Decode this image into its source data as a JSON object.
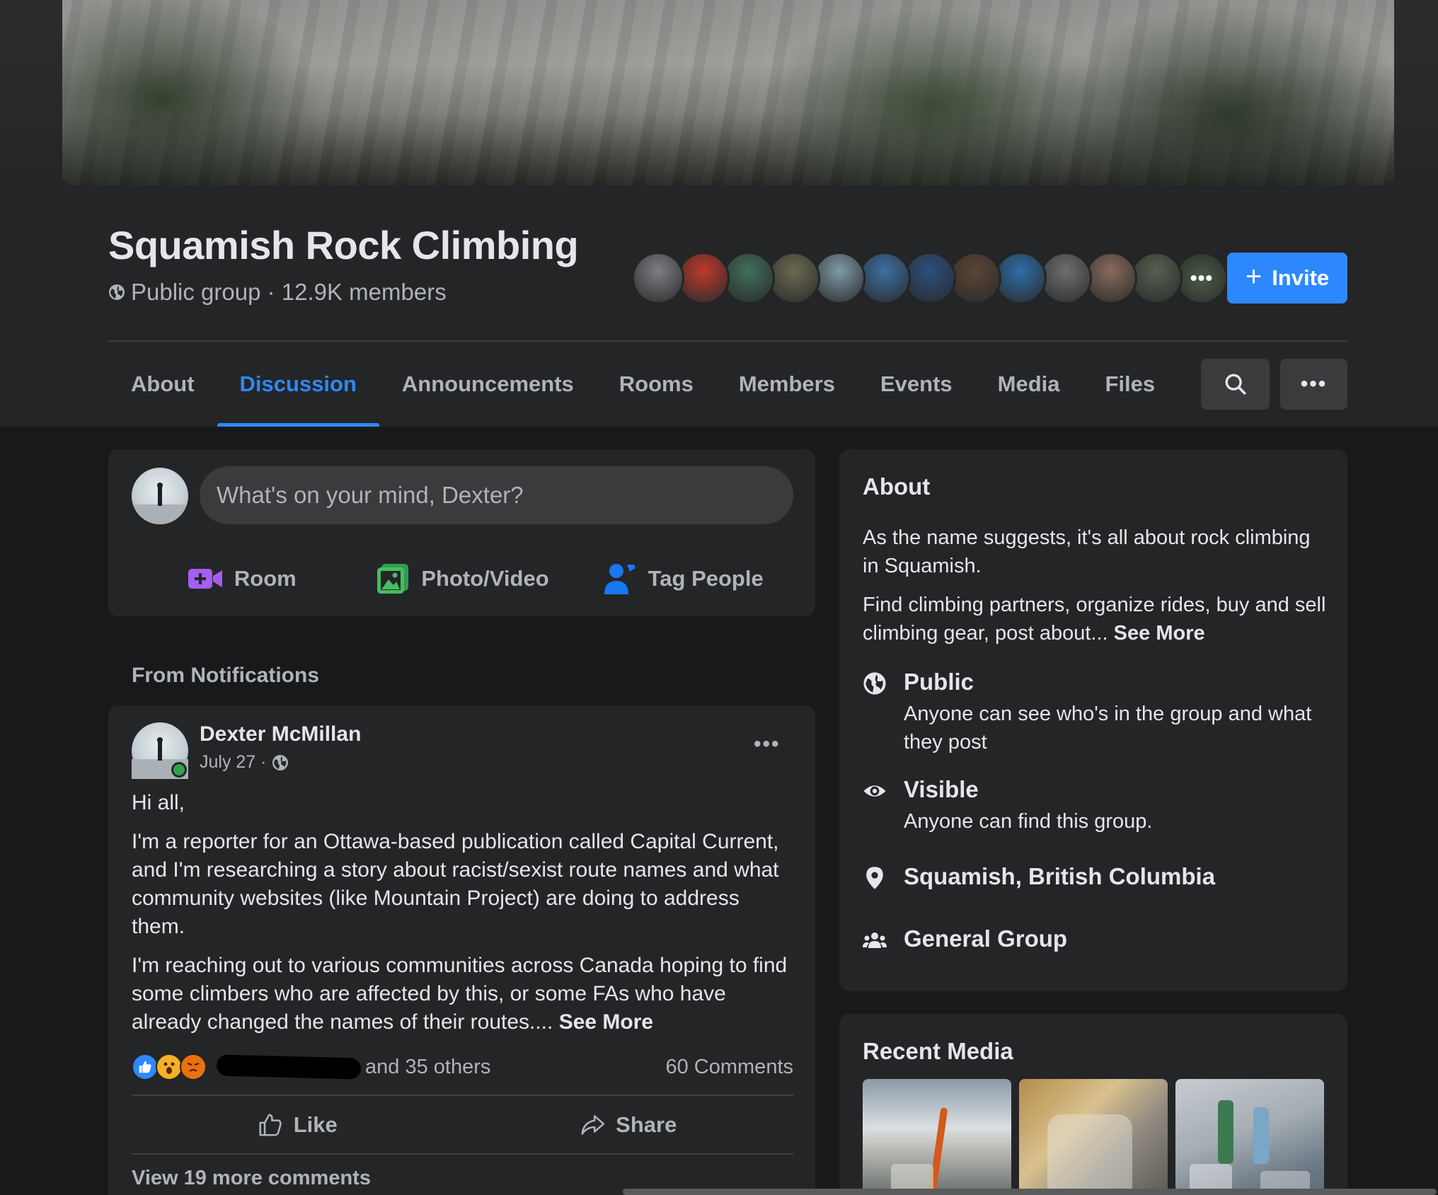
{
  "group": {
    "title": "Squamish Rock Climbing",
    "meta": "Public group · 12.9K members",
    "member_avatar_colors": [
      "#7d7f82",
      "#c0392b",
      "#3f6f5b",
      "#6b6a4f",
      "#7e9aa6",
      "#3d6fa3",
      "#2b4f7e",
      "#5a4535",
      "#2d6ea8",
      "#6e6f70",
      "#8a6b5c",
      "#56604f"
    ],
    "more_avatars_label": "•••"
  },
  "invite": {
    "label": "Invite"
  },
  "tabs": [
    {
      "label": "About",
      "active": false
    },
    {
      "label": "Discussion",
      "active": true
    },
    {
      "label": "Announcements",
      "active": false
    },
    {
      "label": "Rooms",
      "active": false
    },
    {
      "label": "Members",
      "active": false
    },
    {
      "label": "Events",
      "active": false
    },
    {
      "label": "Media",
      "active": false
    },
    {
      "label": "Files",
      "active": false
    }
  ],
  "toolbar": {
    "more_label": "•••"
  },
  "composer": {
    "placeholder": "What's on your mind, Dexter?",
    "actions": [
      {
        "label": "Room",
        "icon": "video-plus-icon",
        "color": "#a45ef2"
      },
      {
        "label": "Photo/Video",
        "icon": "photo-icon",
        "color": "#45bd62"
      },
      {
        "label": "Tag People",
        "icon": "tag-people-icon",
        "color": "#1877f2"
      }
    ]
  },
  "feed": {
    "section_label": "From Notifications"
  },
  "post": {
    "author": "Dexter McMillan",
    "date": "July 27 ·",
    "more_label": "•••",
    "paragraphs": [
      "Hi all,",
      "I'm a reporter for an Ottawa-based publication called Capital Current, and I'm researching a story about racist/sexist route names and what community websites (like Mountain Project) are doing to address them."
    ],
    "last_paragraph": "I'm reaching out to various communities across Canada hoping to find some climbers who are affected by this, or some FAs who have already changed the names of their routes....",
    "see_more": "See More",
    "reactions_text": "and 35 others",
    "comments_count": "60 Comments",
    "like_label": "Like",
    "share_label": "Share",
    "view_more": "View 19 more comments"
  },
  "about": {
    "heading": "About",
    "desc1": "As the name suggests, it's all about rock climbing in Squamish.",
    "desc2": "Find climbing partners, organize rides, buy and sell climbing gear, post about...",
    "see_more": "See More",
    "public_title": "Public",
    "public_sub": "Anyone can see who's in the group and what they post",
    "visible_title": "Visible",
    "visible_sub": "Anyone can find this group.",
    "location": "Squamish, British Columbia",
    "group_type": "General Group"
  },
  "media": {
    "heading": "Recent Media"
  },
  "colors": {
    "accent": "#2d88ff",
    "background": "#18191a",
    "card": "#242526",
    "online": "#31a24c"
  }
}
